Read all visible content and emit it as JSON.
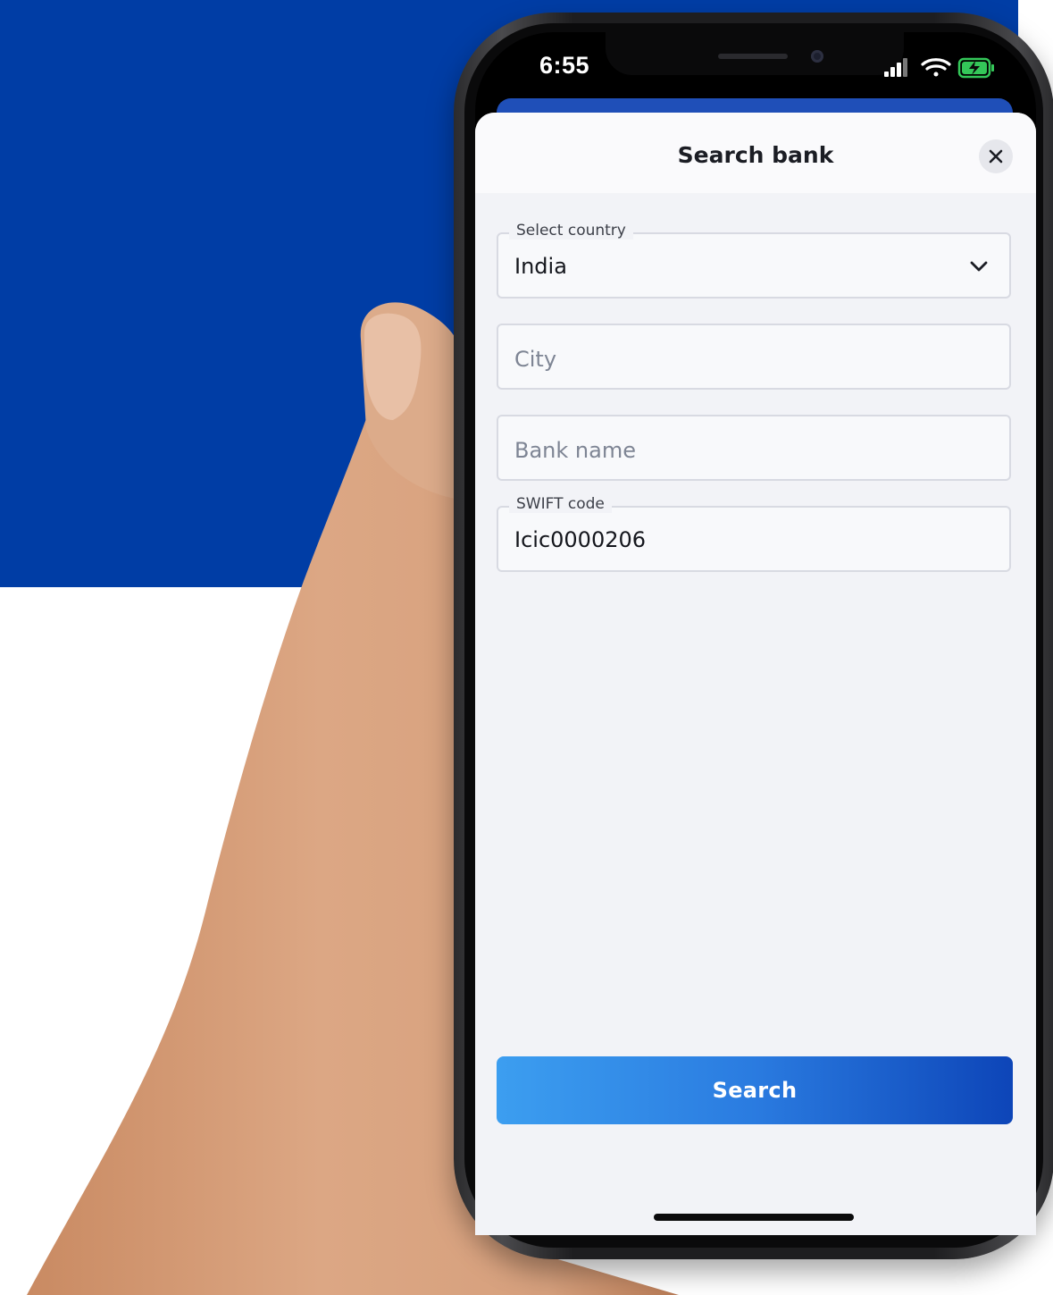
{
  "status_bar": {
    "time": "6:55"
  },
  "sheet": {
    "title": "Search bank",
    "fields": {
      "country": {
        "label": "Select country",
        "value": "India"
      },
      "city": {
        "placeholder": "City"
      },
      "bank_name": {
        "placeholder": "Bank name"
      },
      "swift": {
        "label": "SWIFT code",
        "value": "Icic0000206"
      }
    },
    "search_button": {
      "label": "Search"
    }
  },
  "icons": [
    "close-icon",
    "chevron-down-icon",
    "signal-icon",
    "wifi-icon",
    "battery-charging-icon"
  ],
  "colors": {
    "background_blue": "#003DA5",
    "button_start": "#3c9ef0",
    "button_end": "#0d45b8",
    "battery_green": "#34c759"
  }
}
